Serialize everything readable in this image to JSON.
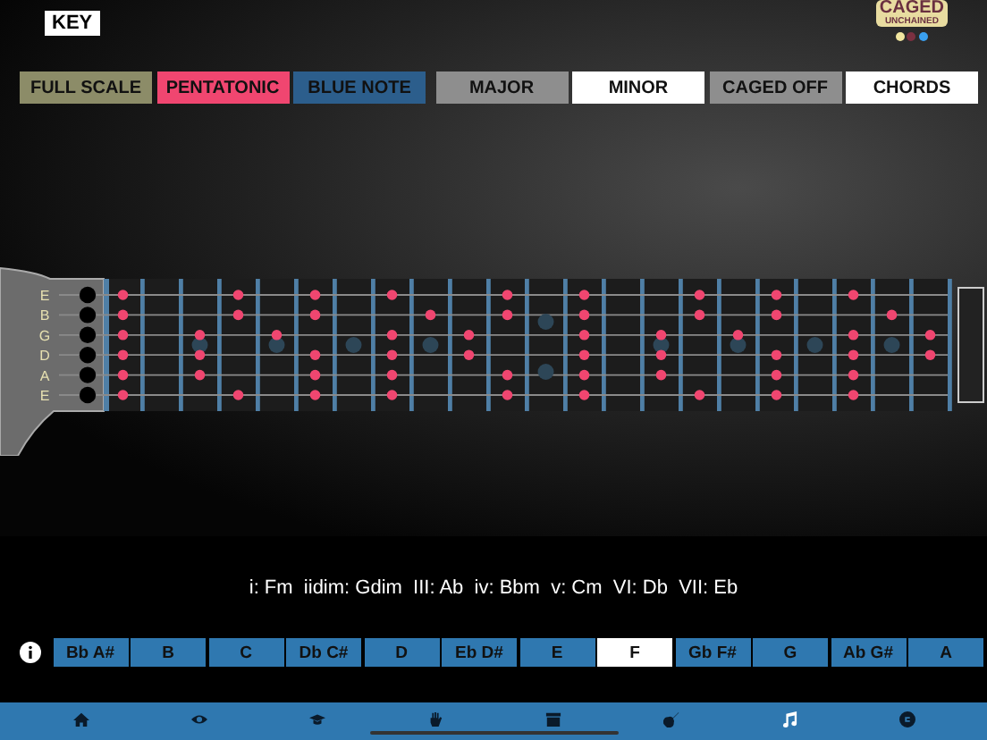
{
  "key_label": "KEY",
  "logo": {
    "line_1": "CAGED",
    "line_2": "UNCHAINED",
    "dots": [
      {
        "color": "#f2e6a0"
      },
      {
        "color": "#7a3040"
      },
      {
        "color": "#3aa0f0"
      }
    ]
  },
  "mode_buttons": [
    {
      "label": "FULL SCALE",
      "kind": "legend",
      "color": "#8c8c68"
    },
    {
      "label": "PENTATONIC",
      "kind": "legend",
      "color": "#f04670"
    },
    {
      "label": "BLUE NOTE",
      "kind": "legend",
      "color": "#2c5e8c"
    },
    {
      "label": "MAJOR",
      "kind": "major",
      "selected": false
    },
    {
      "label": "MINOR",
      "kind": "minor",
      "selected": true
    },
    {
      "label": "CAGED OFF",
      "kind": "caged",
      "selected": false
    },
    {
      "label": "CHORDS",
      "kind": "chords",
      "selected": true
    }
  ],
  "strings": [
    {
      "label": "E"
    },
    {
      "label": "B"
    },
    {
      "label": "G"
    },
    {
      "label": "D"
    },
    {
      "label": "A"
    },
    {
      "label": "E"
    }
  ],
  "chords_text": "i: Fm  iidim: Gdim  III: Ab  iv: Bbm  v: Cm  VI: Db  VII: Eb",
  "keys": [
    {
      "label": "Bb A#",
      "selected": false
    },
    {
      "label": "B",
      "selected": false
    },
    {
      "label": "C",
      "selected": false
    },
    {
      "label": "Db C#",
      "selected": false
    },
    {
      "label": "D",
      "selected": false
    },
    {
      "label": "Eb D#",
      "selected": false
    },
    {
      "label": "E",
      "selected": false
    },
    {
      "label": "F",
      "selected": true
    },
    {
      "label": "Gb F#",
      "selected": false
    },
    {
      "label": "G",
      "selected": false
    },
    {
      "label": "Ab G#",
      "selected": false
    },
    {
      "label": "A",
      "selected": false
    }
  ],
  "tabs": [
    {
      "kind": "home",
      "selected": false
    },
    {
      "kind": "eye",
      "selected": false
    },
    {
      "kind": "cap",
      "selected": false
    },
    {
      "kind": "hand",
      "selected": false
    },
    {
      "kind": "box",
      "selected": false
    },
    {
      "kind": "guitar",
      "selected": false
    },
    {
      "kind": "music",
      "selected": true
    },
    {
      "kind": "circle",
      "selected": false
    }
  ]
}
